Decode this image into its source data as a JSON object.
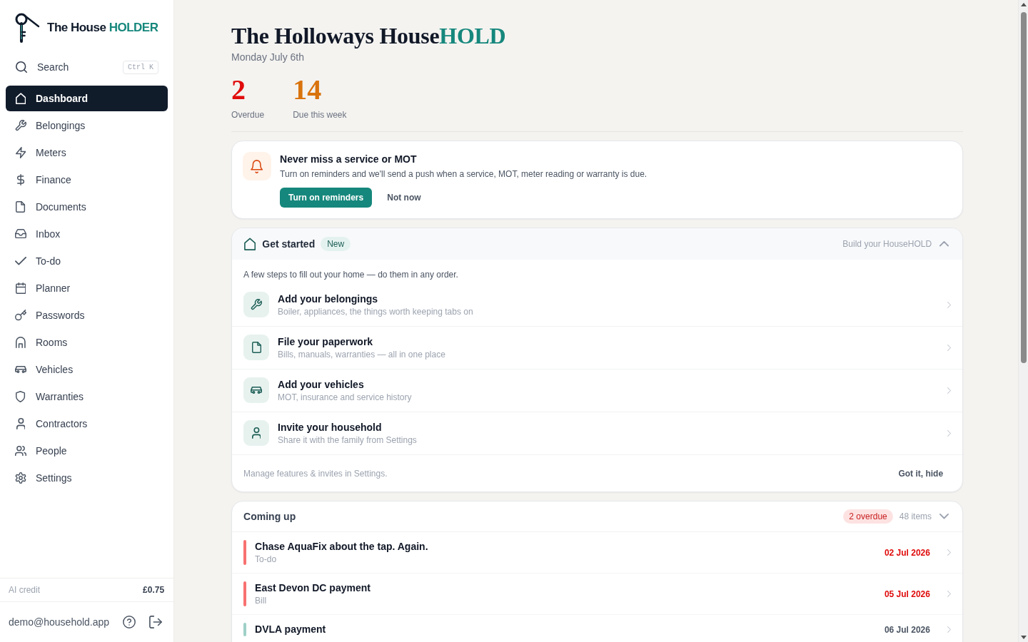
{
  "sidebar": {
    "logo": {
      "text": "The House",
      "accent": "HOLDER"
    },
    "search": {
      "label": "Search",
      "shortcut": "Ctrl K"
    },
    "items": [
      {
        "label": "Dashboard",
        "selected": true
      },
      {
        "label": "Belongings",
        "selected": false
      },
      {
        "label": "Meters",
        "selected": false
      },
      {
        "label": "Finance",
        "selected": false
      },
      {
        "label": "Documents",
        "selected": false
      },
      {
        "label": "Inbox",
        "selected": false
      },
      {
        "label": "To-do",
        "selected": false
      },
      {
        "label": "Planner",
        "selected": false
      },
      {
        "label": "Passwords",
        "selected": false
      },
      {
        "label": "Rooms",
        "selected": false
      },
      {
        "label": "Vehicles",
        "selected": false
      },
      {
        "label": "Warranties",
        "selected": false
      },
      {
        "label": "Contractors",
        "selected": false
      },
      {
        "label": "People",
        "selected": false
      },
      {
        "label": "Settings",
        "selected": false
      }
    ],
    "credit": {
      "label": "AI credit",
      "value": "£0.75"
    },
    "account": {
      "email": "demo@household.app"
    }
  },
  "header": {
    "title": "The Holloways House",
    "title_accent": "HOLD",
    "date": "Monday July 6th",
    "stats": [
      {
        "value": "2",
        "label": "Overdue",
        "color": "#e00b0b"
      },
      {
        "value": "14",
        "label": "Due this week",
        "color": "#d9730d"
      }
    ]
  },
  "reminder": {
    "title": "Never miss a service or MOT",
    "text": "Turn on reminders and we'll send a push when a service, MOT, meter reading or warranty is due.",
    "buttons": [
      {
        "label": "Turn on reminders",
        "kind": "primary"
      },
      {
        "label": "Not now",
        "kind": "plain"
      }
    ]
  },
  "get_started": {
    "title": "Get started",
    "badge": "New",
    "hint": "Build your HouseHOLD",
    "intro": "A few steps to fill out your home — do them in any order.",
    "steps": [
      {
        "title": "Add your belongings",
        "subtitle": "Boiler, appliances, the things worth keeping tabs on"
      },
      {
        "title": "File your paperwork",
        "subtitle": "Bills, manuals, warranties — all in one place"
      },
      {
        "title": "Add your vehicles",
        "subtitle": "MOT, insurance and service history"
      },
      {
        "title": "Invite your household",
        "subtitle": "Share it with the family from Settings"
      }
    ],
    "footer": "Manage features & invites in Settings.",
    "hide_button": "Got it, hide"
  },
  "coming_up": {
    "title": "Coming up",
    "badge": "2 overdue",
    "count": "48 items",
    "items": [
      {
        "title": "Chase AquaFix about the tap. Again.",
        "category": "To-do",
        "date": "02 Jul 2026",
        "overdue": true,
        "color": "#f87171"
      },
      {
        "title": "East Devon DC payment",
        "category": "Bill",
        "date": "05 Jul 2026",
        "overdue": true,
        "color": "#f87171"
      },
      {
        "title": "DVLA payment",
        "date": "06 Jul 2026",
        "overdue": false,
        "color": "#9fd0c7"
      }
    ]
  }
}
